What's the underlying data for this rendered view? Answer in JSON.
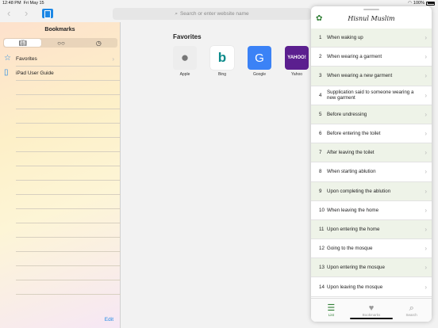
{
  "status": {
    "time": "12:48 PM",
    "date": "Fri May 15",
    "battery": "100%"
  },
  "toolbar": {
    "back": "‹",
    "forward": "›",
    "url_placeholder": "Search or enter website name"
  },
  "sidebar": {
    "title": "Bookmarks",
    "segments": [
      {
        "icon": "book-icon"
      },
      {
        "icon": "reading-list-icon"
      },
      {
        "icon": "history-icon"
      }
    ],
    "items": [
      {
        "label": "Favorites",
        "icon": "star-icon"
      },
      {
        "label": "iPad User Guide",
        "icon": "book-icon"
      }
    ],
    "edit_label": "Edit"
  },
  "favorites": {
    "title": "Favorites",
    "items": [
      {
        "label": "Apple",
        "color": "#ededed"
      },
      {
        "label": "Bing",
        "color": "#ffffff"
      },
      {
        "label": "Google",
        "color": "#3b82f6",
        "glyph": "G"
      },
      {
        "label": "Yahoo",
        "color": "#5b1f8f",
        "glyph": "YAHOO!"
      }
    ]
  },
  "panel": {
    "title": "Hisnul Muslim",
    "accent": "#2e7d32",
    "items": [
      {
        "num": "1",
        "label": "When waking up"
      },
      {
        "num": "2",
        "label": "When wearing a garment"
      },
      {
        "num": "3",
        "label": "When wearing a new garment"
      },
      {
        "num": "4",
        "label": "Supplication said to someone wearing a new garment"
      },
      {
        "num": "5",
        "label": "Before undressing"
      },
      {
        "num": "6",
        "label": "Before entering the toilet"
      },
      {
        "num": "7",
        "label": "After leaving the toilet"
      },
      {
        "num": "8",
        "label": "When starting ablution"
      },
      {
        "num": "9",
        "label": "Upon completing the ablution"
      },
      {
        "num": "10",
        "label": "When leaving the home"
      },
      {
        "num": "11",
        "label": "Upon entering the home"
      },
      {
        "num": "12",
        "label": "Going to the mosque"
      },
      {
        "num": "13",
        "label": "Upon entering the mosque"
      },
      {
        "num": "14",
        "label": "Upon leaving the mosque"
      }
    ],
    "tabs": [
      {
        "label": "List",
        "icon": "list-icon"
      },
      {
        "label": "Bookmarks",
        "icon": "heart-icon"
      },
      {
        "label": "Search",
        "icon": "search-icon"
      }
    ]
  }
}
